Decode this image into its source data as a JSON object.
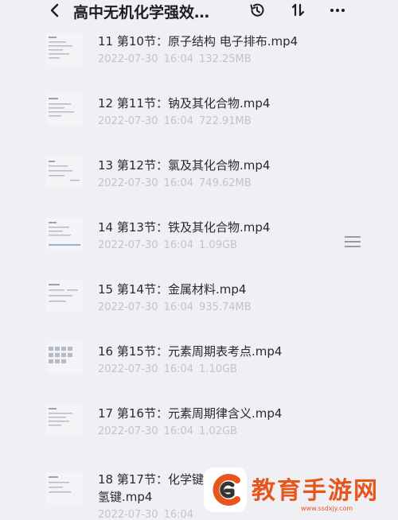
{
  "header": {
    "title": "高中无机化学强效…",
    "icons": {
      "back": "chevron-left-icon",
      "history": "history-icon",
      "sort": "sort-icon",
      "more": "more-dots-icon"
    }
  },
  "files": [
    {
      "name": "11 第10节：原子结构 电子排布.mp4",
      "date": "2022-07-30",
      "time": "16:04",
      "size": "132.25MB"
    },
    {
      "name": "12 第11节：钠及其化合物.mp4",
      "date": "2022-07-30",
      "time": "16:04",
      "size": "722.91MB"
    },
    {
      "name": "13 第12节：氯及其化合物.mp4",
      "date": "2022-07-30",
      "time": "16:04",
      "size": "749.62MB"
    },
    {
      "name": "14 第13节：铁及其化合物.mp4",
      "date": "2022-07-30",
      "time": "16:04",
      "size": "1.09GB"
    },
    {
      "name": "15 第14节：金属材料.mp4",
      "date": "2022-07-30",
      "time": "16:04",
      "size": "935.74MB"
    },
    {
      "name": "16 第15节：元素周期表考点.mp4",
      "date": "2022-07-30",
      "time": "16:04",
      "size": "1.10GB"
    },
    {
      "name": "17 第16节：元素周期律含义.mp4",
      "date": "2022-07-30",
      "time": "16:04",
      "size": "1.02GB"
    },
    {
      "name": "18 第17节：化学键",
      "name_line2": "氢键.mp4",
      "date": "2022-07-30",
      "time": "16:04",
      "size": ""
    }
  ],
  "watermark": {
    "text": "教育手游网",
    "url": "www.ssdxjy.com",
    "colors": {
      "primary": "#e5571c",
      "dark": "#333333"
    }
  },
  "colors": {
    "background": "#f0eff4",
    "title": "#1d1d1f",
    "file_name": "#2a2a2e",
    "meta": "#c3c3c9"
  }
}
